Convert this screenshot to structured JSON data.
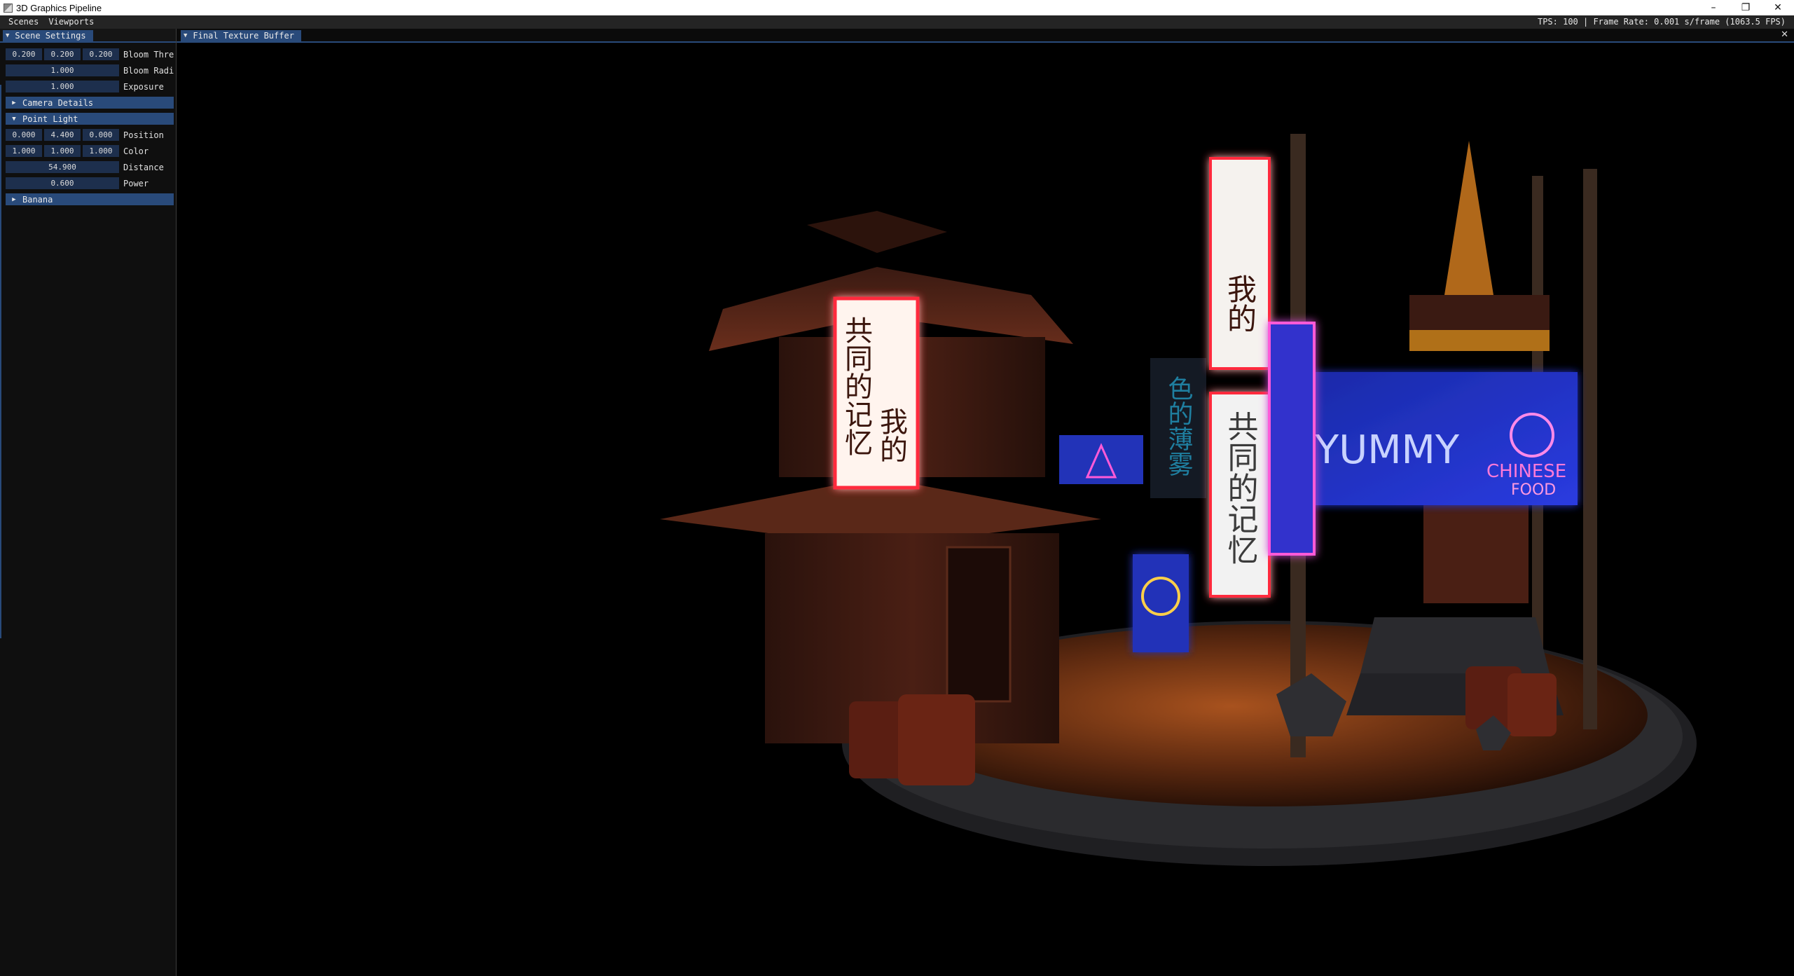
{
  "window": {
    "title": "3D Graphics Pipeline",
    "buttons": {
      "minimize": "–",
      "restore": "❐",
      "close": "✕"
    }
  },
  "menu": {
    "items": [
      "Scenes",
      "Viewports"
    ],
    "stats": "TPS: 100 | Frame Rate: 0.001 s/frame (1063.5 FPS)"
  },
  "scene_settings": {
    "tab": "Scene Settings",
    "bloom_threshold": {
      "values": [
        "0.200",
        "0.200",
        "0.200"
      ],
      "label": "Bloom Threshold"
    },
    "bloom_radius": {
      "value": "1.000",
      "label": "Bloom Radius"
    },
    "exposure": {
      "value": "1.000",
      "label": "Exposure"
    },
    "camera_details": {
      "label": "Camera Details",
      "expanded": false
    },
    "point_light": {
      "label": "Point Light",
      "expanded": true,
      "position": {
        "values": [
          "0.000",
          "4.400",
          "0.000"
        ],
        "label": "Position"
      },
      "color": {
        "values": [
          "1.000",
          "1.000",
          "1.000"
        ],
        "label": "Color"
      },
      "distance": {
        "value": "54.900",
        "label": "Distance"
      },
      "power": {
        "value": "0.600",
        "label": "Power"
      }
    },
    "banana": {
      "label": "Banana",
      "expanded": false
    }
  },
  "viewport": {
    "tab": "Final Texture Buffer",
    "close": "✕"
  },
  "signs": {
    "left_banner_col1": "共同的记忆",
    "left_banner_col2": "我的",
    "top_banner": "我的",
    "center_banner": "共同的记忆",
    "dark_banner": "色的薄雾",
    "yummy": "YUMMY",
    "chinese": "CHINESE",
    "food": "FOOD"
  },
  "colors": {
    "accent": "#294a7a",
    "field": "#1d2f4d",
    "panel_bg": "#0f0f0f",
    "menu_bg": "#242424",
    "neon_red": "#ff2a3c",
    "neon_blue": "#3d5cff",
    "neon_pink": "#ff5ad8",
    "neon_yellow": "#ffcf4a"
  }
}
